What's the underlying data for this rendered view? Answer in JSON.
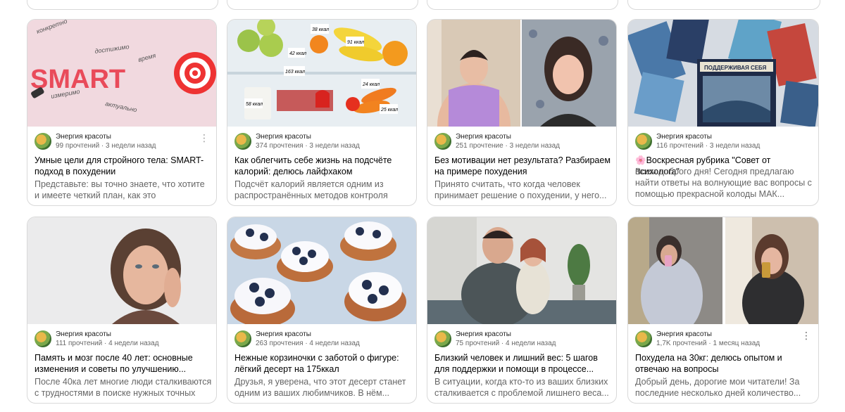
{
  "cards": [
    {
      "channel": "Энергия красоты",
      "stats": "99 прочтений · 3 недели назад",
      "title": "Умные цели для стройного тела: SMART-подход в похудении",
      "desc": "Представьте: вы точно знаете, что хотите и имеете четкий план, как это осуществить...",
      "image_text": [
        "конкретно",
        "достижимо",
        "время",
        "SMART",
        "измеримо",
        "актуально"
      ]
    },
    {
      "channel": "Энергия красоты",
      "stats": "374 прочтения · 3 недели назад",
      "title": "Как облегчить себе жизнь на подсчёте калорий: делюсь лайфхаком",
      "desc": "Подсчёт калорий является одним из распространённых методов контроля свое...",
      "image_text": [
        "38 ккал",
        "91 ккал",
        "42 ккал",
        "163 ккал",
        "58 ккал",
        "24 ккал",
        "25 ккал"
      ]
    },
    {
      "channel": "Энергия красоты",
      "stats": "251 прочтение · 3 недели назад",
      "title": "Без мотивации нет результата? Разбираем на примере похудения",
      "desc": "Принято считать, что когда человек принимает решение о похудении, у него..."
    },
    {
      "channel": "Энергия красоты",
      "stats": "116 прочтений · 3 недели назад",
      "title": "🌸Воскресная рубрика \"Совет от психолога\"",
      "desc": "Всем доброго дня! Сегодня предлагаю найти ответы на волнующие вас вопросы с помощью прекрасной колоды МАК...",
      "image_text": [
        "ПОДДЕРЖИВАЯ СЕБЯ"
      ]
    },
    {
      "channel": "Энергия красоты",
      "stats": "111 прочтений · 4 недели назад",
      "title": "Память и мозг после 40 лет: основные изменения и советы по улучшению...",
      "desc": "После 40ка лет многие люди сталкиваются с трудностями в поиске нужных точных слов..."
    },
    {
      "channel": "Энергия красоты",
      "stats": "263 прочтения · 4 недели назад",
      "title": "Нежные корзиночки с заботой о фигуре: лёгкий десерт на 175ккал",
      "desc": "Друзья, я уверена, что этот десерт станет одним из ваших любимчиков. В нём..."
    },
    {
      "channel": "Энергия красоты",
      "stats": "75 прочтений · 4 недели назад",
      "title": "Близкий человек и лишний вес: 5 шагов для поддержки и помощи в процессе...",
      "desc": "В ситуации, когда кто-то из ваших близких сталкивается с проблемой лишнего веса..."
    },
    {
      "channel": "Энергия красоты",
      "stats": "1,7K прочтений · 1 месяц назад",
      "title": "Похудела на 30кг: делюсь опытом и отвечаю на вопросы",
      "desc": "Добрый день, дорогие мои читатели! За последние несколько дней количество..."
    }
  ]
}
